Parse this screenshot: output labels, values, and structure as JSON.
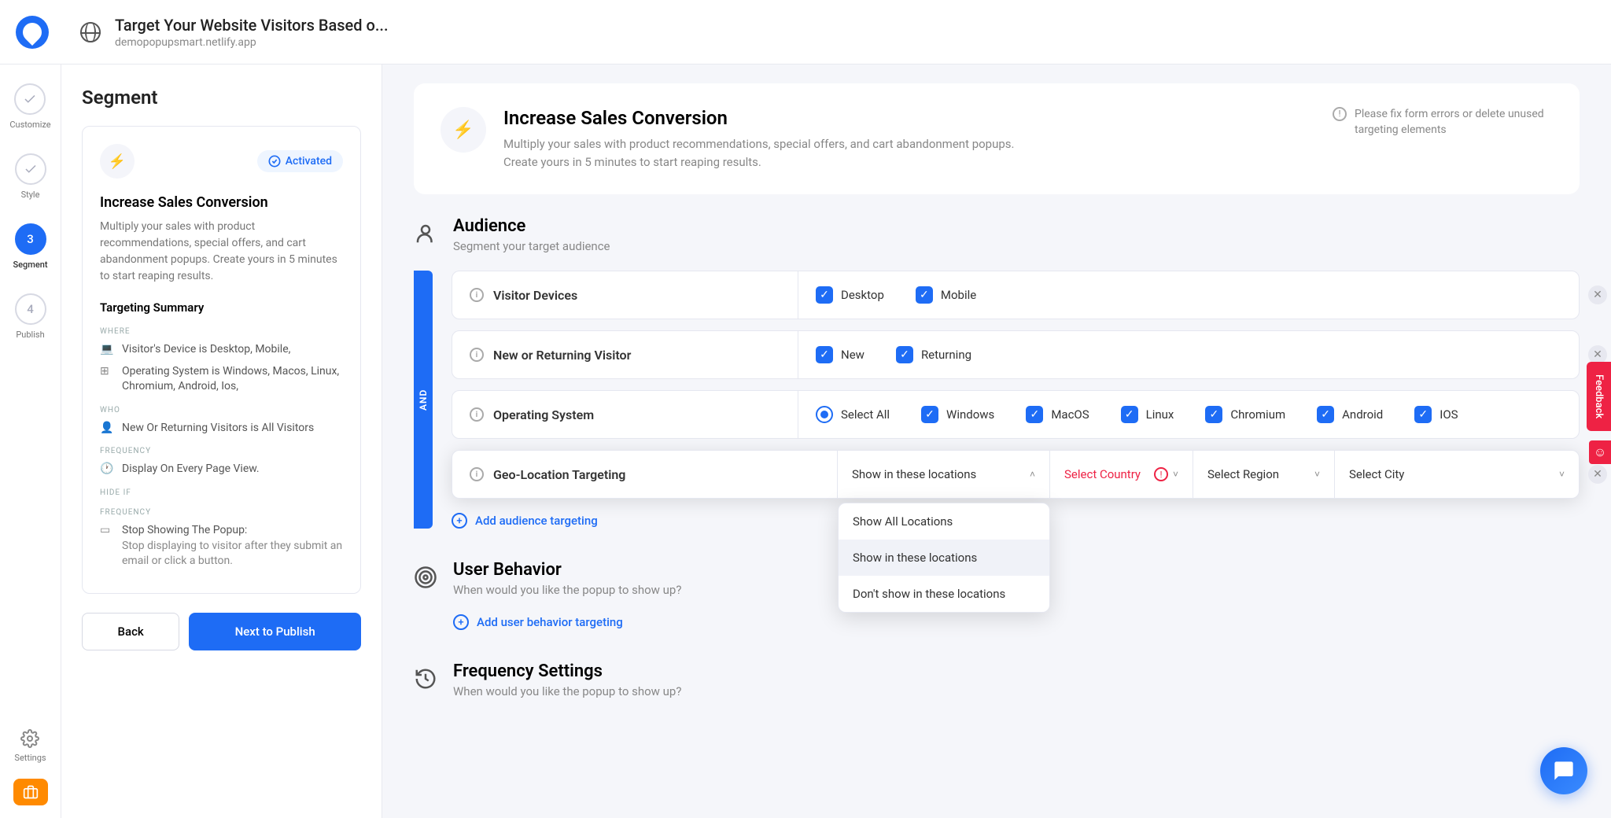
{
  "topbar": {
    "title": "Target Your Website Visitors Based o...",
    "subtitle": "demopopupsmart.netlify.app"
  },
  "rail": {
    "customize": "Customize",
    "style": "Style",
    "segment_num": "3",
    "segment": "Segment",
    "publish_num": "4",
    "publish": "Publish",
    "settings": "Settings"
  },
  "leftpanel": {
    "heading": "Segment",
    "activated": "Activated",
    "card_title": "Increase Sales Conversion",
    "card_desc": "Multiply your sales with product recommendations, special offers, and cart abandonment popups. Create yours in 5 minutes to start reaping results.",
    "targeting_summary": "Targeting Summary",
    "where_label": "WHERE",
    "where1": "Visitor's Device is Desktop, Mobile,",
    "where2": "Operating System is Windows, Macos, Linux, Chromium, Android, Ios,",
    "who_label": "WHO",
    "who1": "New Or Returning Visitors is All Visitors",
    "freq_label": "FREQUENCY",
    "freq1": "Display On Every Page View.",
    "hide_label": "HIDE IF",
    "freq2_label": "FREQUENCY",
    "hide1_title": "Stop Showing The Popup:",
    "hide1_body": "Stop displaying to visitor after they submit an email or click a button.",
    "back": "Back",
    "next": "Next to Publish"
  },
  "hero": {
    "title": "Increase Sales Conversion",
    "desc": "Multiply your sales with product recommendations, special offers, and cart abandonment popups. Create yours in 5 minutes to start reaping results.",
    "warning": "Please fix form errors or delete unused targeting elements"
  },
  "audience": {
    "title": "Audience",
    "subtitle": "Segment your target audience",
    "and": "AND",
    "rules": {
      "visitor_devices": "Visitor Devices",
      "desktop": "Desktop",
      "mobile": "Mobile",
      "new_returning": "New or Returning Visitor",
      "new": "New",
      "returning": "Returning",
      "os": "Operating System",
      "select_all": "Select All",
      "windows": "Windows",
      "macos": "MacOS",
      "linux": "Linux",
      "chromium": "Chromium",
      "android": "Android",
      "ios": "IOS",
      "geo": "Geo-Location Targeting",
      "show_in": "Show in these locations",
      "country": "Select Country",
      "region": "Select Region",
      "city": "Select City"
    },
    "dropdown": {
      "opt1": "Show All Locations",
      "opt2": "Show in these locations",
      "opt3": "Don't show in these locations"
    },
    "add_audience": "Add audience targeting"
  },
  "behavior": {
    "title": "User Behavior",
    "subtitle": "When would you like the popup to show up?",
    "add": "Add user behavior targeting"
  },
  "freq": {
    "title": "Frequency Settings",
    "subtitle": "When would you like the popup to show up?"
  },
  "feedback": "Feedback"
}
